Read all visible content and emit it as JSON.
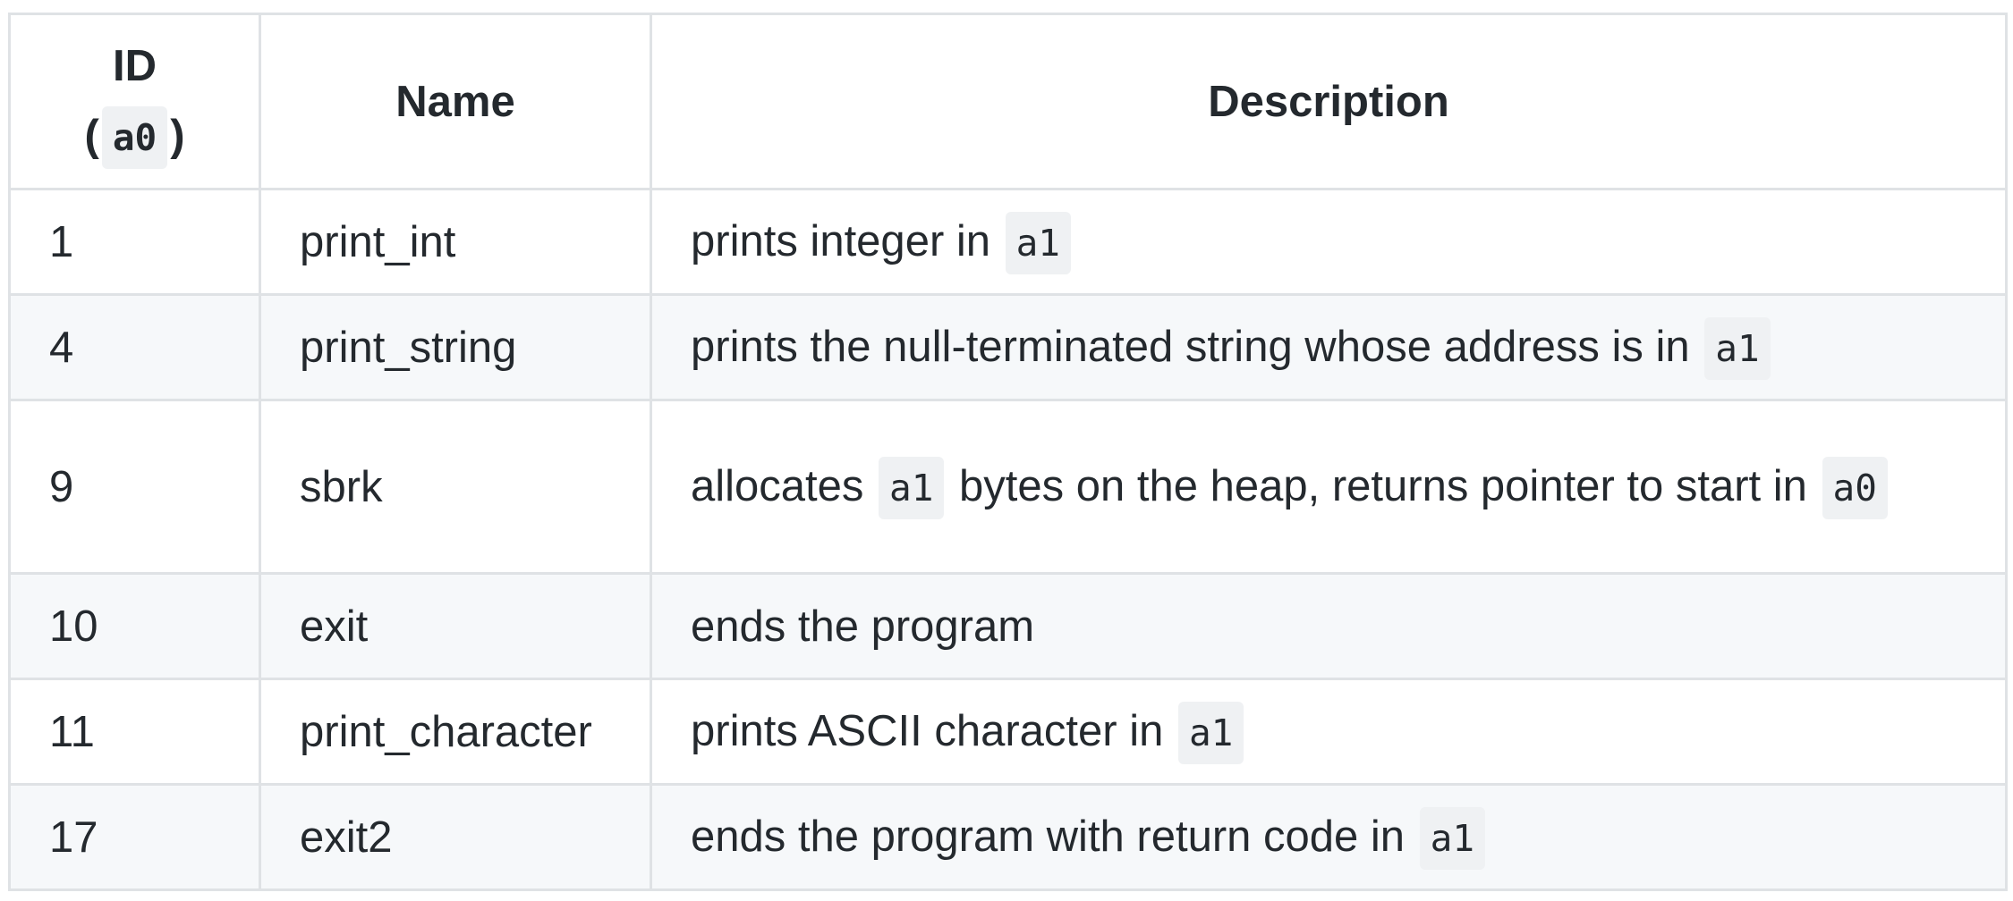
{
  "headers": {
    "id_label": "ID",
    "id_open": "(",
    "id_code": "a0",
    "id_close": ")",
    "name": "Name",
    "description": "Description"
  },
  "rows": [
    {
      "id": "1",
      "name": "print_int",
      "desc_pre": "prints integer in ",
      "code1": "a1"
    },
    {
      "id": "4",
      "name": "print_string",
      "desc_pre": "prints the null-terminated string whose address is in ",
      "code1": "a1"
    },
    {
      "id": "9",
      "name": "sbrk",
      "desc_pre": "allocates ",
      "code1": "a1",
      "desc_mid": " bytes on the heap, returns pointer to start in ",
      "code2": "a0"
    },
    {
      "id": "10",
      "name": "exit",
      "desc_pre": "ends the program"
    },
    {
      "id": "11",
      "name": "print_character",
      "desc_pre": "prints ASCII character in ",
      "code1": "a1"
    },
    {
      "id": "17",
      "name": "exit2",
      "desc_pre": "ends the program with return code in ",
      "code1": "a1"
    }
  ],
  "colors": {
    "border": "#dfe2e5",
    "stripe": "#f6f8fa",
    "code_bg": "#eff1f3",
    "text": "#24292e"
  }
}
